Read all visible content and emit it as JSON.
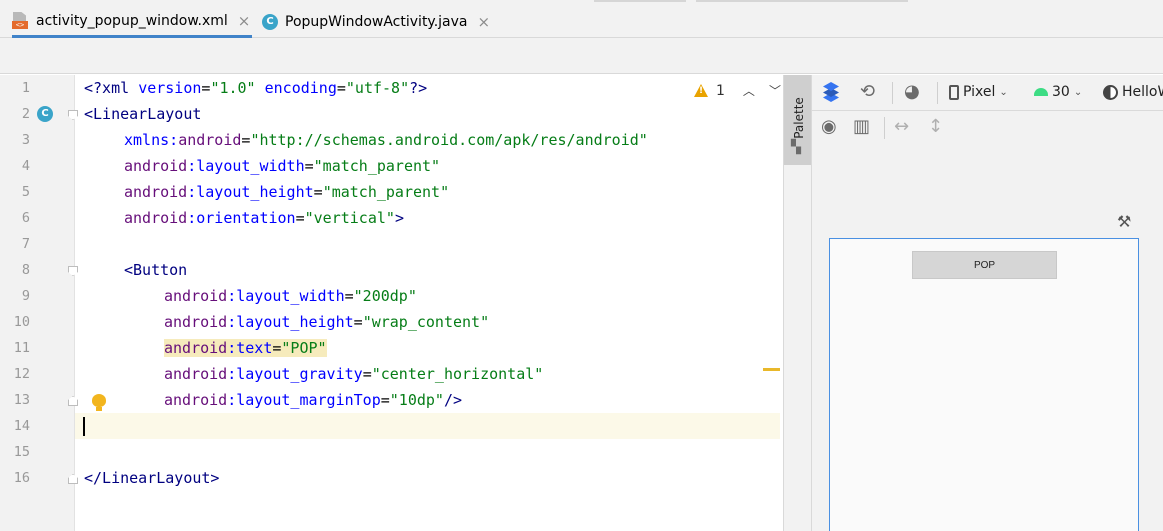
{
  "tabs": [
    {
      "label": "activity_popup_window.xml",
      "close": "×",
      "active": true
    },
    {
      "label": "PopupWindowActivity.java",
      "close": "×",
      "active": false
    }
  ],
  "editor": {
    "lines": [
      {
        "num": "1"
      },
      {
        "num": "2"
      },
      {
        "num": "3"
      },
      {
        "num": "4"
      },
      {
        "num": "5"
      },
      {
        "num": "6"
      },
      {
        "num": "7"
      },
      {
        "num": "8"
      },
      {
        "num": "9"
      },
      {
        "num": "10"
      },
      {
        "num": "11"
      },
      {
        "num": "12"
      },
      {
        "num": "13"
      },
      {
        "num": "14"
      },
      {
        "num": "15"
      },
      {
        "num": "16"
      }
    ],
    "tokens": {
      "l1_a": "<?xml ",
      "l1_b": "version",
      "l1_c": "=",
      "l1_d": "\"1.0\"",
      "l1_e": " ",
      "l1_f": "encoding",
      "l1_g": "=",
      "l1_h": "\"utf-8\"",
      "l1_i": "?>",
      "l2_a": "<LinearLayout",
      "l3_a": "xmlns:",
      "l3_b": "android",
      "l3_c": "=",
      "l3_d": "\"http://schemas.android.com/apk/res/android\"",
      "l4_a": "android",
      "l4_b": ":layout_width",
      "l4_c": "=",
      "l4_d": "\"match_parent\"",
      "l5_a": "android",
      "l5_b": ":layout_height",
      "l5_c": "=",
      "l5_d": "\"match_parent\"",
      "l6_a": "android",
      "l6_b": ":orientation",
      "l6_c": "=",
      "l6_d": "\"vertical\"",
      "l6_e": ">",
      "l8_a": "<Button",
      "l9_a": "android",
      "l9_b": ":layout_width",
      "l9_c": "=",
      "l9_d": "\"200dp\"",
      "l10_a": "android",
      "l10_b": ":layout_height",
      "l10_c": "=",
      "l10_d": "\"wrap_content\"",
      "l11_a": "android",
      "l11_b": ":text",
      "l11_c": "=",
      "l11_d": "\"POP\"",
      "l12_a": "android",
      "l12_b": ":layout_gravity",
      "l12_c": "=",
      "l12_d": "\"center_horizontal\"",
      "l13_a": "android",
      "l13_b": ":layout_marginTop",
      "l13_c": "=",
      "l13_d": "\"10dp\"",
      "l13_e": "/>",
      "l16_a": "</LinearLayout>"
    },
    "current_line": 14,
    "inspection": {
      "warning_count": "1",
      "icon": "warning-icon"
    },
    "colors": {
      "tag": "#000080",
      "namespace": "#660e7a",
      "attribute": "#0000ff",
      "value": "#067d17",
      "current_line_bg": "#fcf9e8"
    }
  },
  "palette": {
    "label": "Palette"
  },
  "design_toolbar": {
    "device": "Pixel",
    "api_level": "30",
    "theme": "HelloW"
  },
  "preview": {
    "button_label": "POP",
    "accent": "#4a90e2"
  }
}
